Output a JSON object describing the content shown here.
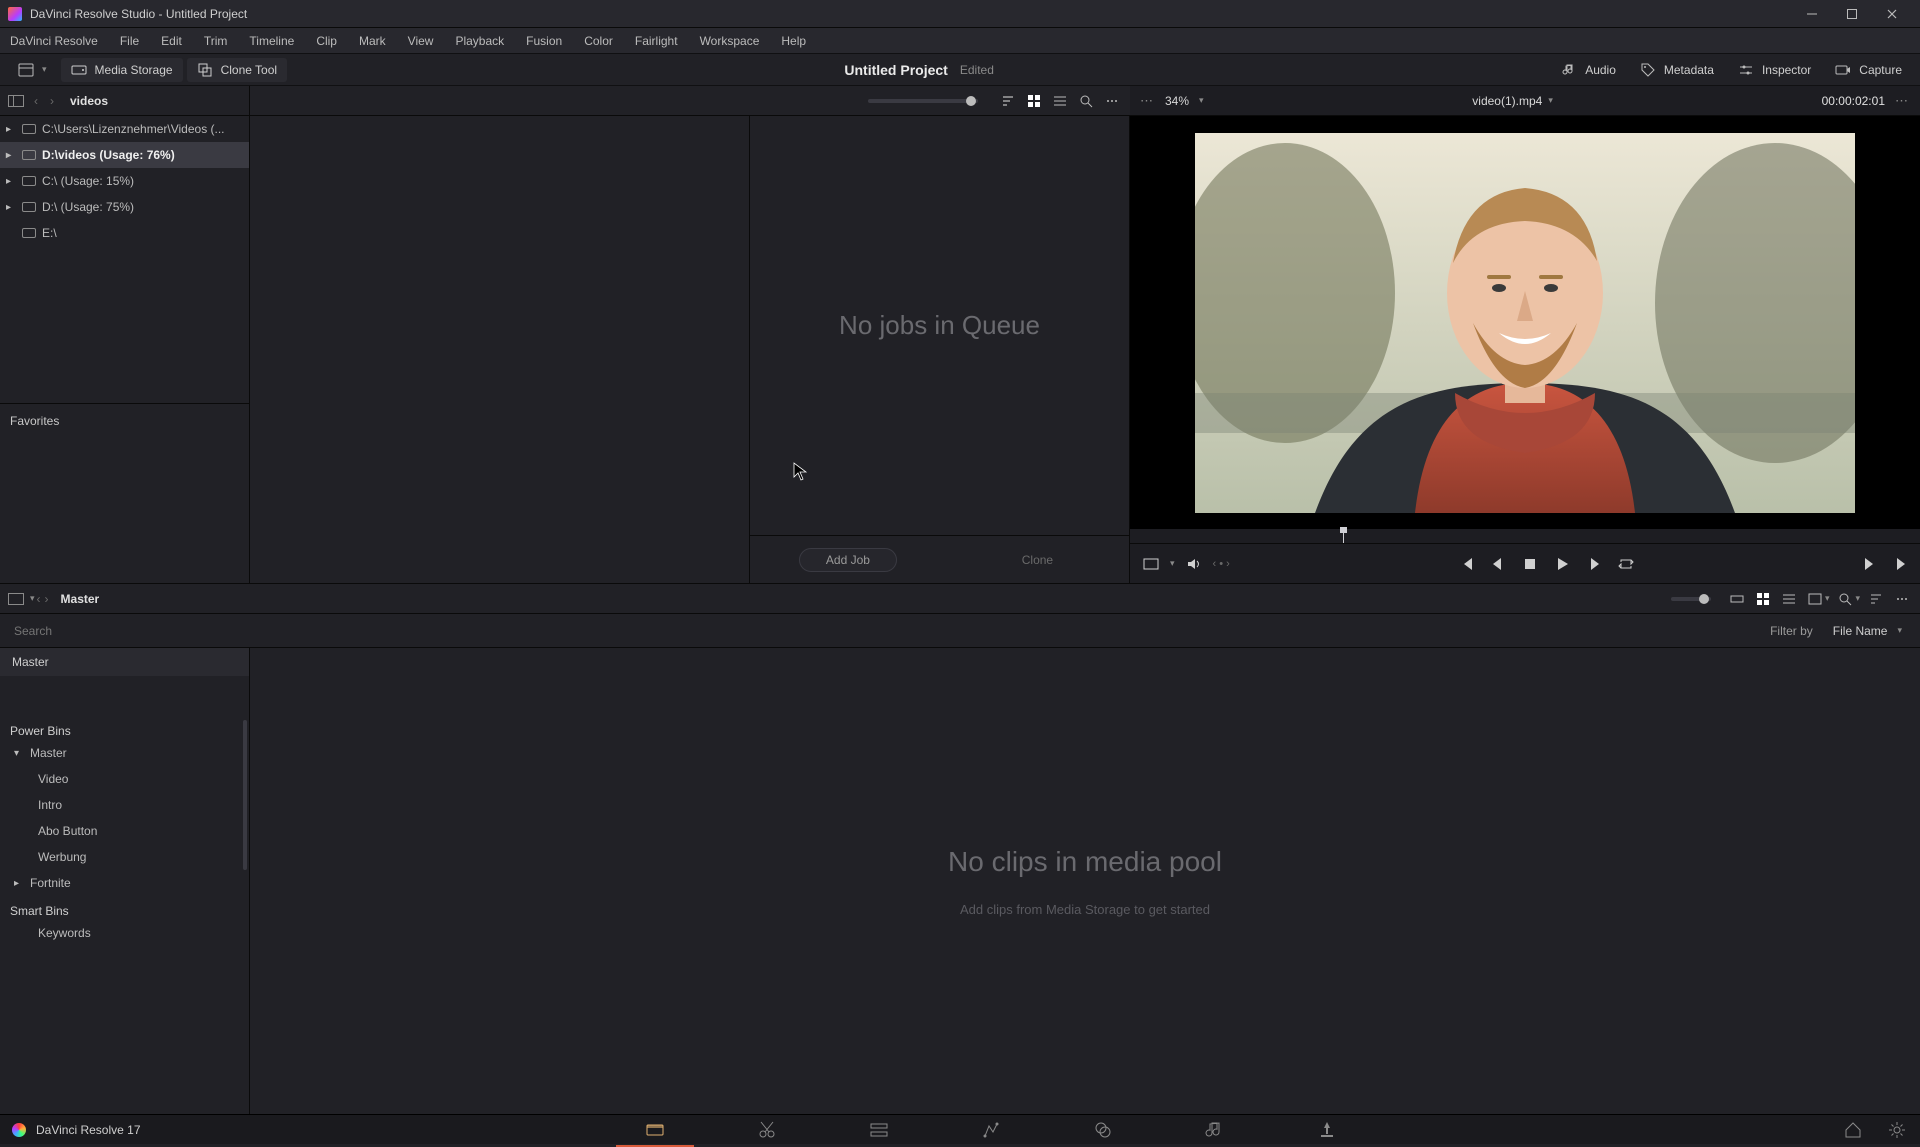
{
  "window": {
    "title": "DaVinci Resolve Studio - Untitled Project"
  },
  "menu": [
    "DaVinci Resolve",
    "File",
    "Edit",
    "Trim",
    "Timeline",
    "Clip",
    "Mark",
    "View",
    "Playback",
    "Fusion",
    "Color",
    "Fairlight",
    "Workspace",
    "Help"
  ],
  "toolbar": {
    "media_storage": "Media Storage",
    "clone_tool": "Clone Tool",
    "project_title": "Untitled Project",
    "project_status": "Edited",
    "audio": "Audio",
    "metadata": "Metadata",
    "inspector": "Inspector",
    "capture": "Capture"
  },
  "media_storage": {
    "crumb": "videos",
    "items": [
      {
        "label": "C:\\Users\\Lizenznehmer\\Videos (...",
        "selected": false
      },
      {
        "label": "D:\\videos (Usage: 76%)",
        "selected": true
      },
      {
        "label": "C:\\ (Usage: 15%)",
        "selected": false
      },
      {
        "label": "D:\\ (Usage: 75%)",
        "selected": false
      },
      {
        "label": "E:\\",
        "selected": false
      }
    ],
    "favorites": "Favorites"
  },
  "queue": {
    "empty_msg": "No jobs in Queue",
    "add_job": "Add Job",
    "clone": "Clone"
  },
  "viewer": {
    "zoom": "34%",
    "clip_name": "video(1).mp4",
    "timecode": "00:00:02:01"
  },
  "media_pool": {
    "crumb": "Master",
    "search_placeholder": "Search",
    "filter_label": "Filter by",
    "filter_value": "File Name",
    "master_label": "Master",
    "power_bins": "Power Bins",
    "pb_items": [
      "Master",
      "Video",
      "Intro",
      "Abo Button",
      "Werbung",
      "Fortnite"
    ],
    "smart_bins": "Smart Bins",
    "sb_items": [
      "Keywords"
    ],
    "empty_big": "No clips in media pool",
    "empty_hint": "Add clips from Media Storage to get started"
  },
  "footer": {
    "brand": "DaVinci Resolve 17"
  }
}
